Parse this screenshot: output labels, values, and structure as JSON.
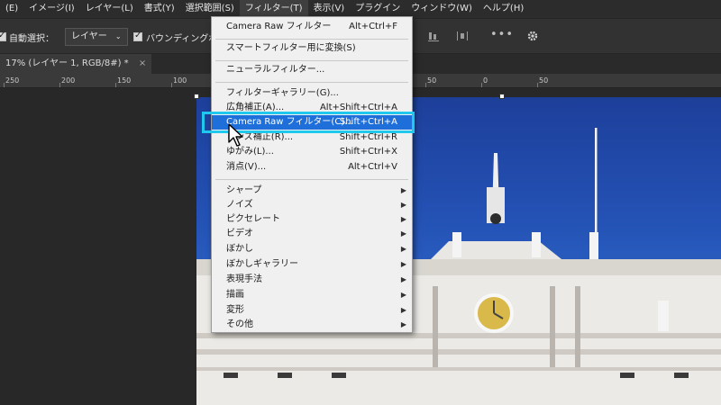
{
  "menubar": {
    "items": [
      "(E)",
      "イメージ(I)",
      "レイヤー(L)",
      "書式(Y)",
      "選択範囲(S)",
      "フィルター(T)",
      "表示(V)",
      "プラグイン",
      "ウィンドウ(W)",
      "ヘルプ(H)"
    ]
  },
  "options": {
    "auto_select_label": "自動選択：",
    "auto_select_value": "レイヤー",
    "bounding_label": "バウンディングボ"
  },
  "document": {
    "tab_label": "17% (レイヤー 1, RGB/8#) *",
    "close": "×"
  },
  "ruler": {
    "labels": [
      "250",
      "200",
      "150",
      "100",
      "50",
      "0",
      "50"
    ]
  },
  "filter_menu": {
    "items": [
      {
        "label": "Camera Raw フィルター",
        "shortcut": "Alt+Ctrl+F"
      },
      {
        "label": "スマートフィルター用に変換(S)",
        "shortcut": ""
      },
      {
        "label": "ニューラルフィルター...",
        "shortcut": ""
      },
      {
        "label": "フィルターギャラリー(G)...",
        "shortcut": ""
      },
      {
        "label": "広角補正(A)...",
        "shortcut": "Alt+Shift+Ctrl+A"
      },
      {
        "label": "Camera Raw フィルター(C)...",
        "shortcut": "Shift+Ctrl+A"
      },
      {
        "label": "レンズ補正(R)...",
        "shortcut": "Shift+Ctrl+R"
      },
      {
        "label": "ゆがみ(L)...",
        "shortcut": "Shift+Ctrl+X"
      },
      {
        "label": "消点(V)...",
        "shortcut": "Alt+Ctrl+V"
      },
      {
        "label": "シャープ",
        "shortcut": ""
      },
      {
        "label": "ノイズ",
        "shortcut": ""
      },
      {
        "label": "ピクセレート",
        "shortcut": ""
      },
      {
        "label": "ビデオ",
        "shortcut": ""
      },
      {
        "label": "ぼかし",
        "shortcut": ""
      },
      {
        "label": "ぼかしギャラリー",
        "shortcut": ""
      },
      {
        "label": "表現手法",
        "shortcut": ""
      },
      {
        "label": "描画",
        "shortcut": ""
      },
      {
        "label": "変形",
        "shortcut": ""
      },
      {
        "label": "その他",
        "shortcut": ""
      }
    ]
  },
  "icons": {
    "checkbox": "checkbox-checked-icon",
    "dropdown": "chevron-down-icon",
    "more": "more-options-icon",
    "gear": "gear-icon",
    "submenu": "submenu-arrow-icon",
    "cursor": "mouse-cursor-icon"
  },
  "colors": {
    "highlight": "#1e6fd9",
    "focus_ring": "#21c8ee",
    "menu_bg": "#f0f0f0"
  }
}
